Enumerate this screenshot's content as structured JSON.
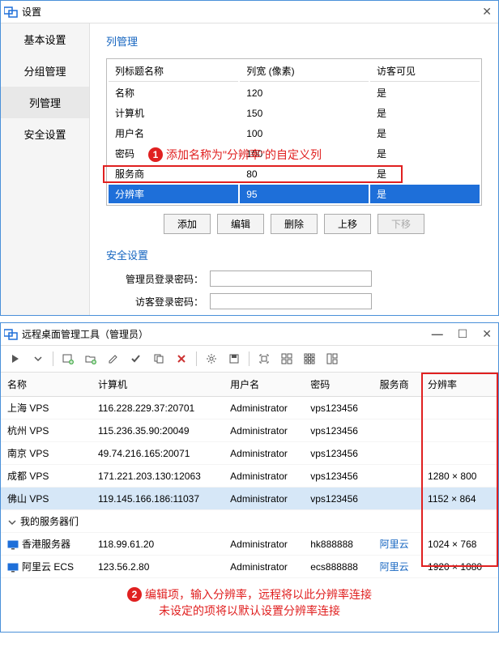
{
  "settings": {
    "title": "设置",
    "sidebar": [
      "基本设置",
      "分组管理",
      "列管理",
      "安全设置"
    ],
    "active_sidebar": 2,
    "section_title": "列管理",
    "columns_header": [
      "列标题名称",
      "列宽 (像素)",
      "访客可见"
    ],
    "columns": [
      {
        "name": "名称",
        "width": "120",
        "visible": "是"
      },
      {
        "name": "计算机",
        "width": "150",
        "visible": "是"
      },
      {
        "name": "用户名",
        "width": "100",
        "visible": "是"
      },
      {
        "name": "密码",
        "width": "100",
        "visible": "是"
      },
      {
        "name": "服务商",
        "width": "80",
        "visible": "是"
      },
      {
        "name": "分辨率",
        "width": "95",
        "visible": "是"
      }
    ],
    "selected_col": 5,
    "buttons": {
      "add": "添加",
      "edit": "编辑",
      "delete": "删除",
      "up": "上移",
      "down": "下移"
    },
    "security_title": "安全设置",
    "admin_pwd_label": "管理员登录密码：",
    "guest_pwd_label": "访客登录密码：",
    "callout1": "添加名称为\"分辨率\"的自定义列"
  },
  "main": {
    "title": "远程桌面管理工具（管理员）",
    "headers": [
      "名称",
      "计算机",
      "用户名",
      "密码",
      "服务商",
      "分辨率"
    ],
    "rows": [
      {
        "name": "上海 VPS",
        "host": "116.228.229.37:20701",
        "user": "Administrator",
        "pwd": "vps123456",
        "provider": "",
        "res": ""
      },
      {
        "name": "杭州 VPS",
        "host": "115.236.35.90:20049",
        "user": "Administrator",
        "pwd": "vps123456",
        "provider": "",
        "res": ""
      },
      {
        "name": "南京 VPS",
        "host": "49.74.216.165:20071",
        "user": "Administrator",
        "pwd": "vps123456",
        "provider": "",
        "res": ""
      },
      {
        "name": "成都 VPS",
        "host": "171.221.203.130:12063",
        "user": "Administrator",
        "pwd": "vps123456",
        "provider": "",
        "res": "1280 × 800"
      },
      {
        "name": "佛山 VPS",
        "host": "119.145.166.186:11037",
        "user": "Administrator",
        "pwd": "vps123456",
        "provider": "",
        "res": "1152 × 864"
      }
    ],
    "selected_row": 4,
    "group_name": "我的服务器们",
    "group_rows": [
      {
        "name": "香港服务器",
        "host": "118.99.61.20",
        "user": "Administrator",
        "pwd": "hk888888",
        "provider": "阿里云",
        "res": "1024 × 768"
      },
      {
        "name": "阿里云 ECS",
        "host": "123.56.2.80",
        "user": "Administrator",
        "pwd": "ecs888888",
        "provider": "阿里云",
        "res": "1920 × 1080"
      }
    ],
    "callout2_line1": "编辑项，输入分辨率，远程将以此分辨率连接",
    "callout2_line2": "未设定的项将以默认设置分辨率连接"
  }
}
